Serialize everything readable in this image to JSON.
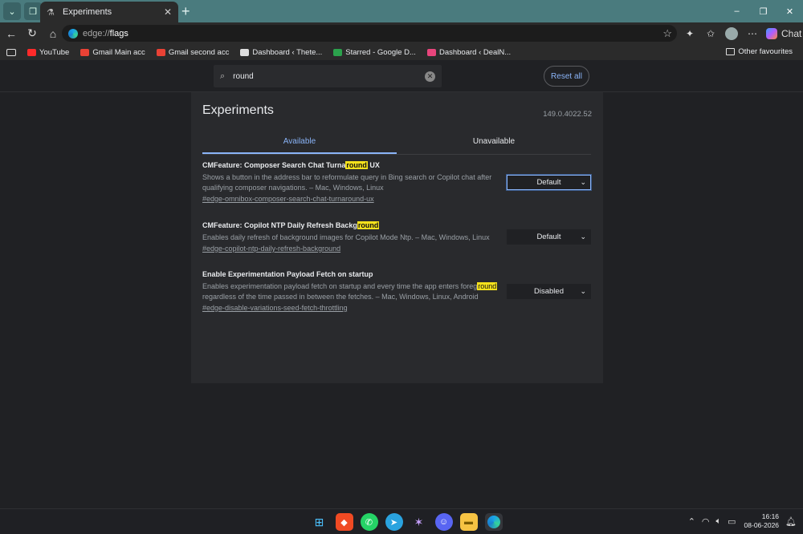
{
  "tab": {
    "title": "Experiments",
    "close": "✕"
  },
  "window": {
    "minimize": "–",
    "restore": "❐",
    "close": "✕",
    "newtab": "+"
  },
  "address": {
    "scheme": "edge://",
    "path": "flags"
  },
  "chat_label": "Chat",
  "bookmarks": [
    {
      "label": "YouTube",
      "color": "#ff2a2a"
    },
    {
      "label": "Gmail Main acc",
      "color": "#e94235"
    },
    {
      "label": "Gmail second acc",
      "color": "#e94235"
    },
    {
      "label": "Dashboard ‹ Thete...",
      "color": "#dddddd"
    },
    {
      "label": "Starred - Google D...",
      "color": "#2ba24c"
    },
    {
      "label": "Dashboard ‹ DealN...",
      "color": "#e8457c"
    }
  ],
  "other_favourites": "Other favourites",
  "search": {
    "value": "round"
  },
  "reset_label": "Reset all",
  "page": {
    "title": "Experiments",
    "version": "149.0.4022.52"
  },
  "tabs": {
    "available": "Available",
    "unavailable": "Unavailable"
  },
  "flags": [
    {
      "title_pre": "CMFeature: Composer Search Chat Turna",
      "title_hl": "round",
      "title_post": " UX",
      "desc_pre": "Shows a button in the address bar to reformulate query in Bing search or Copilot chat after qualifying composer navigations. – Mac, Windows, Linux",
      "desc_hl": "",
      "desc_post": "",
      "anchor": "#edge-omnibox-composer-search-chat-turnaround-ux",
      "value": "Default"
    },
    {
      "title_pre": "CMFeature: Copilot NTP Daily Refresh Backg",
      "title_hl": "round",
      "title_post": "",
      "desc_pre": "Enables daily refresh of background images for Copilot Mode Ntp. – Mac, Windows, Linux",
      "desc_hl": "",
      "desc_post": "",
      "anchor": "#edge-copilot-ntp-daily-refresh-background",
      "value": "Default"
    },
    {
      "title_pre": "Enable Experimentation Payload Fetch on startup",
      "title_hl": "",
      "title_post": "",
      "desc_pre": "Enables experimentation payload fetch on startup and every time the app enters foreg",
      "desc_hl": "round",
      "desc_post": " regardless of the time passed in between the fetches. – Mac, Windows, Linux, Android",
      "anchor": "#edge-disable-variations-seed-fetch-throttling",
      "value": "Disabled"
    }
  ],
  "clock": {
    "time": "16:16",
    "date": "08-06-2026"
  }
}
